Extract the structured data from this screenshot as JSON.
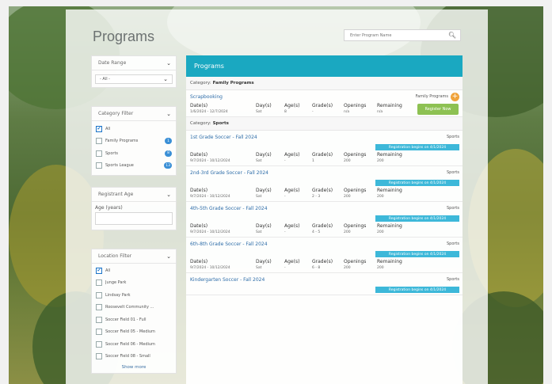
{
  "page": {
    "title": "Programs"
  },
  "search": {
    "placeholder": "Enter Program Name"
  },
  "filters": {
    "date_range": {
      "label": "Date Range",
      "selected": "- All -"
    },
    "category": {
      "label": "Category Filter",
      "items": [
        {
          "label": "All",
          "checked": true,
          "count": ""
        },
        {
          "label": "Family Programs",
          "checked": false,
          "count": "1"
        },
        {
          "label": "Sports",
          "checked": false,
          "count": "8"
        },
        {
          "label": "Sports League",
          "checked": false,
          "count": "13"
        }
      ]
    },
    "registrant_age": {
      "label": "Registrant Age",
      "field_label": "Age (years)"
    },
    "location": {
      "label": "Location Filter",
      "items": [
        {
          "label": "All",
          "checked": true
        },
        {
          "label": "Junge Park",
          "checked": false
        },
        {
          "label": "Lindsay Park",
          "checked": false
        },
        {
          "label": "Roosevelt Community ...",
          "checked": false
        },
        {
          "label": "Soccer Field 01 - Full",
          "checked": false
        },
        {
          "label": "Soccer Field 05 - Medium",
          "checked": false
        },
        {
          "label": "Soccer Field 06 - Medium",
          "checked": false
        },
        {
          "label": "Soccer Field 08 - Small",
          "checked": false
        }
      ],
      "show_more": "Show more"
    }
  },
  "programs_panel": {
    "title": "Programs",
    "category_prefix": "Category:",
    "headers": {
      "dates": "Date(s)",
      "days": "Day(s)",
      "ages": "Age(s)",
      "grades": "Grade(s)",
      "openings": "Openings",
      "remaining": "Remaining"
    },
    "register_now": "Register Now",
    "categories": [
      {
        "name": "Family Programs",
        "programs": [
          {
            "name": "Scrapbooking",
            "tag": "Family Programs",
            "dates": "1/6/2024 - 12/7/2024",
            "days": "Sat",
            "ages": "8",
            "grades": "-",
            "openings": "n/a",
            "remaining": "n/a"
          }
        ]
      },
      {
        "name": "Sports",
        "programs": [
          {
            "name": "1st Grade Soccer - Fall 2024",
            "tag": "Sports",
            "badge": "Registration begins on 4/1/2024",
            "dates": "9/7/2024 - 10/12/2024",
            "days": "Sat",
            "ages": "-",
            "grades": "1",
            "openings": "200",
            "remaining": "200"
          },
          {
            "name": "2nd-3rd Grade Soccer - Fall 2024",
            "tag": "Sports",
            "badge": "Registration begins on 4/1/2024",
            "dates": "9/7/2024 - 10/12/2024",
            "days": "Sat",
            "ages": "-",
            "grades": "2 - 3",
            "openings": "200",
            "remaining": "200"
          },
          {
            "name": "4th-5th Grade Soccer - Fall 2024",
            "tag": "Sports",
            "badge": "Registration begins on 4/1/2024",
            "dates": "9/7/2024 - 10/12/2024",
            "days": "Sat",
            "ages": "-",
            "grades": "4 - 5",
            "openings": "200",
            "remaining": "200"
          },
          {
            "name": "6th-8th Grade Soccer - Fall 2024",
            "tag": "Sports",
            "badge": "Registration begins on 4/1/2024",
            "dates": "9/7/2024 - 10/12/2024",
            "days": "Sat",
            "ages": "-",
            "grades": "6 - 8",
            "openings": "200",
            "remaining": "200"
          },
          {
            "name": "Kindergarten Soccer - Fall 2024",
            "tag": "Sports",
            "badge": "Registration begins on 4/1/2024"
          }
        ]
      }
    ]
  },
  "colors": {
    "header_bar": "#1aa8c1",
    "badge": "#3db8d9",
    "register_button": "#8dc152",
    "count_badge": "#3a8fd6",
    "add_button": "#f0a33a"
  }
}
